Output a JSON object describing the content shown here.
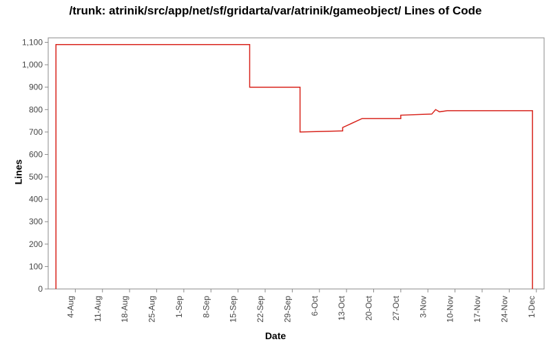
{
  "chart_data": {
    "type": "line",
    "title": "/trunk: atrinik/src/app/net/sf/gridarta/var/atrinik/gameobject/ Lines of Code",
    "xlabel": "Date",
    "ylabel": "Lines",
    "ylim": [
      0,
      1120
    ],
    "y_ticks": [
      0,
      100,
      200,
      300,
      400,
      500,
      600,
      700,
      800,
      900,
      1000,
      1100
    ],
    "x_categories": [
      "4-Aug",
      "11-Aug",
      "18-Aug",
      "25-Aug",
      "1-Sep",
      "8-Sep",
      "15-Sep",
      "22-Sep",
      "29-Sep",
      "6-Oct",
      "13-Oct",
      "20-Oct",
      "27-Oct",
      "3-Nov",
      "10-Nov",
      "17-Nov",
      "24-Nov",
      "1-Dec"
    ],
    "series": [
      {
        "name": "Lines of Code",
        "points": [
          {
            "x": "30-Jul",
            "y": 0
          },
          {
            "x": "30-Jul",
            "y": 1090
          },
          {
            "x": "18-Sep",
            "y": 1090
          },
          {
            "x": "18-Sep",
            "y": 900
          },
          {
            "x": "1-Oct",
            "y": 900
          },
          {
            "x": "1-Oct",
            "y": 700
          },
          {
            "x": "12-Oct",
            "y": 705
          },
          {
            "x": "12-Oct",
            "y": 720
          },
          {
            "x": "17-Oct",
            "y": 760
          },
          {
            "x": "27-Oct",
            "y": 760
          },
          {
            "x": "27-Oct",
            "y": 775
          },
          {
            "x": "4-Nov",
            "y": 780
          },
          {
            "x": "5-Nov",
            "y": 800
          },
          {
            "x": "6-Nov",
            "y": 790
          },
          {
            "x": "8-Nov",
            "y": 795
          },
          {
            "x": "30-Nov",
            "y": 795
          },
          {
            "x": "30-Nov",
            "y": 0
          }
        ]
      }
    ]
  }
}
